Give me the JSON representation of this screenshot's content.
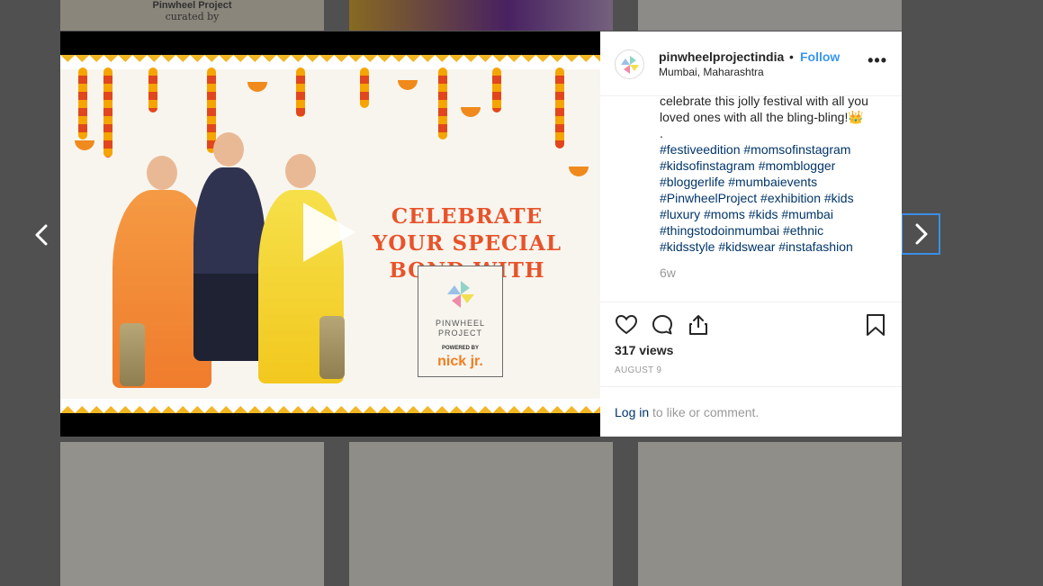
{
  "background_tiles": {
    "tile_a_title": "Pinwheel Project",
    "tile_a_subtitle": "curated by"
  },
  "post": {
    "username": "pinwheelprojectindia",
    "separator": "•",
    "follow_label": "Follow",
    "location": "Mumbai, Maharashtra",
    "more_label": "•••",
    "caption_lines": [
      "celebrate this jolly festival with all you",
      "loved ones with all the bling-bling!👑",
      "."
    ],
    "hashtag_lines": [
      "#festiveedition #momsofinstagram",
      "#kidsofinstagram #momblogger",
      "#bloggerlife #mumbaievents",
      "#PinwheelProject #exhibition #kids",
      "#luxury #moms #kids #mumbai",
      "#thingstodoinmumbai #ethnic",
      "#kidsstyle #kidswear #instafashion"
    ],
    "time_ago": "6w",
    "views": "317 views",
    "date": "AUGUST 9",
    "login_link": "Log in",
    "login_rest": " to like or comment."
  },
  "media": {
    "headline_lines": [
      "CELEBRATE",
      "YOUR SPECIAL",
      "BOND WITH"
    ],
    "logo_text_lines": [
      "PINWHEEL",
      "PROJECT"
    ],
    "logo_powered": "POWERED BY",
    "logo_brand": "nick jr."
  },
  "colors": {
    "accent": "#3897f0",
    "hashtag": "#003569",
    "headline": "#e8532a",
    "garland_yellow": "#f3b623"
  },
  "icons": {
    "like": "heart-icon",
    "comment": "comment-icon",
    "share": "share-icon",
    "save": "bookmark-icon",
    "prev": "chevron-left-icon",
    "next": "chevron-right-icon",
    "play": "play-icon"
  }
}
